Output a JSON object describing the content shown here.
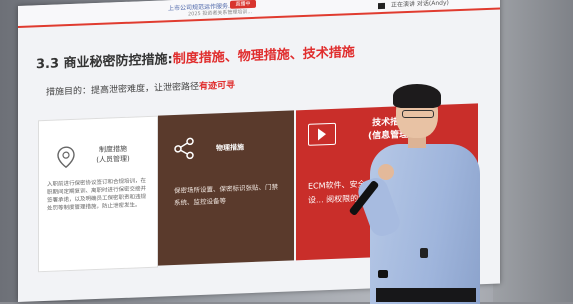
{
  "slide": {
    "header_nav": "上市公司规范运作服务...",
    "header_sub": "2025 投资者关系管理培训...",
    "rec_badge": "直播中",
    "right_tool": "正在演讲    对话(Andy)",
    "title_prefix": "3.3 商业秘密防控措施:",
    "title_highlight": "制度措施、物理措施、技术措施",
    "goal_prefix": "措施目的：提高泄密难度，让泄密路径",
    "goal_highlight": "有迹可寻",
    "cards": [
      {
        "label": "制度措施\n(人员管理)",
        "body": "入职前进行保密协议签订和合规培训，在职期间定期复训、离职时进行保密交接并签署承诺，以及明确员工保密职责和违规处罚等制度管理措施，防止泄密发生。"
      },
      {
        "label": "物理措施",
        "body": "保密场所设置、保密标识张贴、门禁系统、监控设备等"
      },
      {
        "label": "技术措施\n(信息管理)",
        "body": "ECM软件、安全.. 上网权限的设... 阅权限的设..."
      }
    ]
  },
  "icons": [
    "location-pin-icon",
    "share-icon",
    "play-icon"
  ],
  "colors": {
    "accent_red": "#e02d2d",
    "card_brown": "#5a3a2c",
    "card_red": "#c92e2a"
  }
}
